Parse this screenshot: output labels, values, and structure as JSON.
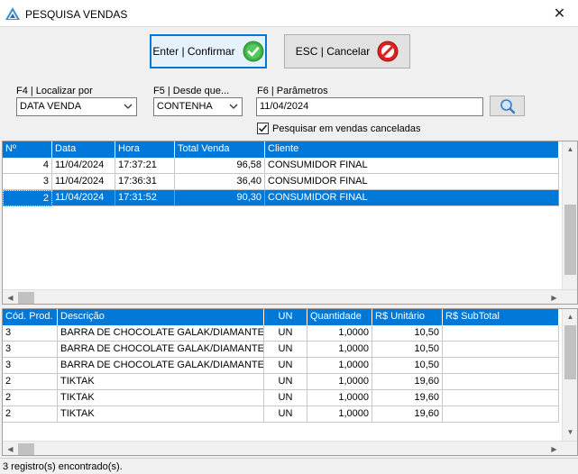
{
  "window": {
    "title": "PESQUISA VENDAS",
    "close_glyph": "✕"
  },
  "toolbar": {
    "confirm_label": "Enter | Confirmar",
    "cancel_label": "ESC | Cancelar"
  },
  "filters": {
    "locate_label": "F4 | Localizar por",
    "locate_value": "DATA VENDA",
    "mode_label": "F5 | Desde que...",
    "mode_value": "CONTENHA",
    "params_label": "F6 | Parâmetros",
    "params_value": "11/04/2024",
    "cancelled_label": "Pesquisar em vendas canceladas",
    "cancelled_checked": true
  },
  "sales_grid": {
    "columns": [
      "Nº",
      "Data",
      "Hora",
      "Total Venda",
      "Cliente"
    ],
    "rows": [
      {
        "num": "4",
        "date": "11/04/2024",
        "time": "17:37:21",
        "total": "96,58",
        "client": "CONSUMIDOR FINAL"
      },
      {
        "num": "3",
        "date": "11/04/2024",
        "time": "17:36:31",
        "total": "36,40",
        "client": "CONSUMIDOR FINAL"
      },
      {
        "num": "2",
        "date": "11/04/2024",
        "time": "17:31:52",
        "total": "90,30",
        "client": "CONSUMIDOR FINAL"
      }
    ],
    "selected_index": 2
  },
  "items_grid": {
    "columns": [
      "Cód. Prod.",
      "Descrição",
      "UN",
      "Quantidade",
      "R$ Unitário",
      "R$ SubTotal"
    ],
    "rows": [
      {
        "code": "3",
        "desc": "BARRA DE CHOCOLATE GALAK/DIAMANTE NEGRO",
        "un": "UN",
        "qty": "1,0000",
        "unit": "10,50",
        "subtotal": ""
      },
      {
        "code": "3",
        "desc": "BARRA DE CHOCOLATE GALAK/DIAMANTE NEGRO",
        "un": "UN",
        "qty": "1,0000",
        "unit": "10,50",
        "subtotal": ""
      },
      {
        "code": "3",
        "desc": "BARRA DE CHOCOLATE GALAK/DIAMANTE NEGRO",
        "un": "UN",
        "qty": "1,0000",
        "unit": "10,50",
        "subtotal": ""
      },
      {
        "code": "2",
        "desc": "TIKTAK",
        "un": "UN",
        "qty": "1,0000",
        "unit": "19,60",
        "subtotal": ""
      },
      {
        "code": "2",
        "desc": "TIKTAK",
        "un": "UN",
        "qty": "1,0000",
        "unit": "19,60",
        "subtotal": ""
      },
      {
        "code": "2",
        "desc": "TIKTAK",
        "un": "UN",
        "qty": "1,0000",
        "unit": "19,60",
        "subtotal": ""
      }
    ]
  },
  "status": {
    "text": "3 registro(s) encontrado(s)."
  },
  "colors": {
    "accent": "#0078d7",
    "confirm_icon": "#3cb043",
    "cancel_icon": "#e02020"
  }
}
